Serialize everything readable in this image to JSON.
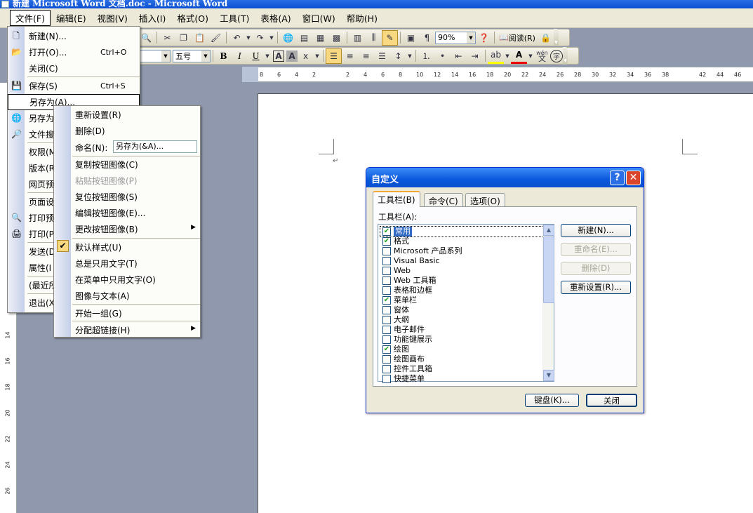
{
  "window": {
    "title": "新建 Microsoft Word 文档.doc - Microsoft Word"
  },
  "menubar": [
    {
      "label": "文件(F)"
    },
    {
      "label": "编辑(E)"
    },
    {
      "label": "视图(V)"
    },
    {
      "label": "插入(I)"
    },
    {
      "label": "格式(O)"
    },
    {
      "label": "工具(T)"
    },
    {
      "label": "表格(A)"
    },
    {
      "label": "窗口(W)"
    },
    {
      "label": "帮助(H)"
    }
  ],
  "toolbar": {
    "zoom": "90%",
    "read_label": "阅读(R)",
    "font_size": "五号",
    "bold": "B",
    "italic": "I",
    "underline": "U",
    "font_color": "A",
    "char_border": "A",
    "wen": "wén"
  },
  "ruler": {
    "h_ticks": [
      "8",
      "6",
      "4",
      "2",
      "2",
      "4",
      "6",
      "8",
      "10",
      "12",
      "14",
      "16",
      "18",
      "20",
      "22",
      "24",
      "26",
      "28",
      "30",
      "32",
      "34",
      "36",
      "38",
      "42",
      "44",
      "46"
    ],
    "v_ticks": [
      "14",
      "16",
      "18",
      "20",
      "22",
      "24",
      "26"
    ]
  },
  "file_menu": {
    "items": [
      {
        "label": "新建(N)...",
        "shortcut": ""
      },
      {
        "label": "打开(O)...",
        "shortcut": "Ctrl+O"
      },
      {
        "label": "关闭(C)",
        "shortcut": ""
      },
      {
        "label": "保存(S)",
        "shortcut": "Ctrl+S"
      },
      {
        "label": "另存为(A)...",
        "shortcut": ""
      },
      {
        "label": "另存为",
        "shortcut": ""
      },
      {
        "label": "文件搜",
        "shortcut": ""
      },
      {
        "label": "权限(M",
        "shortcut": ""
      },
      {
        "label": "版本(R",
        "shortcut": ""
      },
      {
        "label": "网页预",
        "shortcut": ""
      },
      {
        "label": "页面设",
        "shortcut": ""
      },
      {
        "label": "打印预",
        "shortcut": ""
      },
      {
        "label": "打印(P",
        "shortcut": ""
      },
      {
        "label": "发送(D",
        "shortcut": ""
      },
      {
        "label": "属性(I",
        "shortcut": ""
      },
      {
        "label": "(最近所",
        "shortcut": ""
      },
      {
        "label": "退出(X",
        "shortcut": ""
      }
    ]
  },
  "context_menu": {
    "items": [
      {
        "label": "重新设置(R)"
      },
      {
        "label": "删除(D)"
      },
      {
        "label": "命名(N):"
      },
      {
        "label": "复制按钮图像(C)"
      },
      {
        "label": "粘贴按钮图像(P)"
      },
      {
        "label": "复位按钮图像(S)"
      },
      {
        "label": "编辑按钮图像(E)..."
      },
      {
        "label": "更改按钮图像(B)"
      },
      {
        "label": "默认样式(U)"
      },
      {
        "label": "总是只用文字(T)"
      },
      {
        "label": "在菜单中只用文字(O)"
      },
      {
        "label": "图像与文本(A)"
      },
      {
        "label": "开始一组(G)"
      },
      {
        "label": "分配超链接(H)"
      }
    ],
    "rename_value": "另存为(&A)..."
  },
  "dialog": {
    "title": "自定义",
    "help": "?",
    "close": "✕",
    "tabs": [
      {
        "label": "工具栏(B)"
      },
      {
        "label": "命令(C)"
      },
      {
        "label": "选项(O)"
      }
    ],
    "list_label": "工具栏(A):",
    "toolbars": [
      {
        "name": "常用",
        "checked": true
      },
      {
        "name": "格式",
        "checked": true
      },
      {
        "name": "Microsoft 产品系列",
        "checked": false
      },
      {
        "name": "Visual Basic",
        "checked": false
      },
      {
        "name": "Web",
        "checked": false
      },
      {
        "name": "Web 工具箱",
        "checked": false
      },
      {
        "name": "表格和边框",
        "checked": false
      },
      {
        "name": "菜单栏",
        "checked": true
      },
      {
        "name": "窗体",
        "checked": false
      },
      {
        "name": "大纲",
        "checked": false
      },
      {
        "name": "电子邮件",
        "checked": false
      },
      {
        "name": "功能键展示",
        "checked": false
      },
      {
        "name": "绘图",
        "checked": true
      },
      {
        "name": "绘图画布",
        "checked": false
      },
      {
        "name": "控件工具箱",
        "checked": false
      },
      {
        "name": "快捷菜单",
        "checked": false
      }
    ],
    "buttons": {
      "new": "新建(N)...",
      "rename": "重命名(E)...",
      "delete": "删除(D)",
      "reset": "重新设置(R)...",
      "keyboard": "键盘(K)...",
      "close": "关闭"
    }
  }
}
